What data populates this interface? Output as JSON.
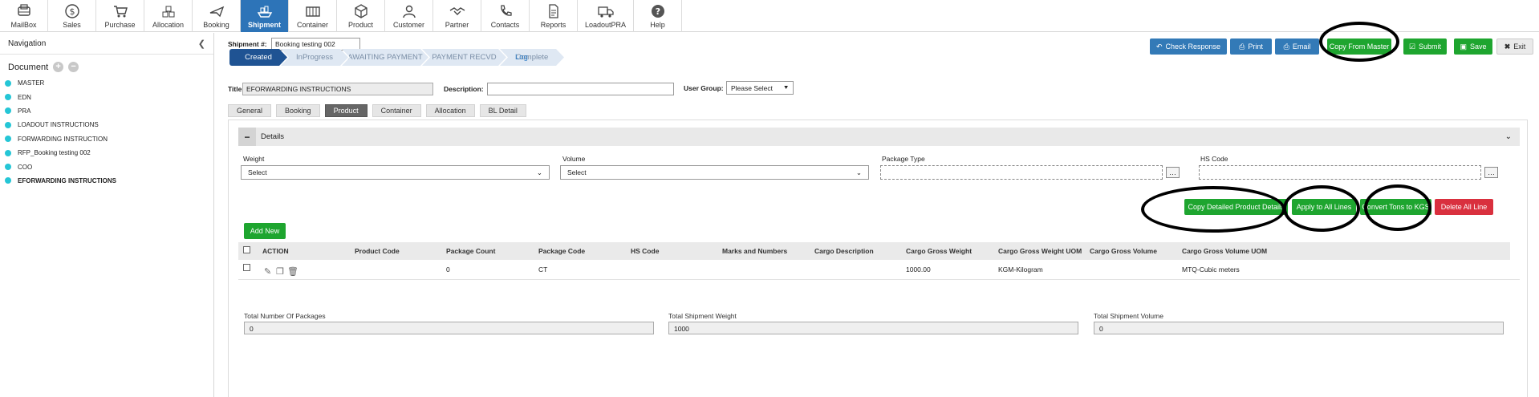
{
  "topnav": [
    {
      "label": "MailBox",
      "icon": "mailbox-icon"
    },
    {
      "label": "Sales",
      "icon": "dollar-icon"
    },
    {
      "label": "Purchase",
      "icon": "cart-icon"
    },
    {
      "label": "Allocation",
      "icon": "allocation-icon"
    },
    {
      "label": "Booking",
      "icon": "plane-icon"
    },
    {
      "label": "Shipment",
      "icon": "ship-icon",
      "active": true
    },
    {
      "label": "Container",
      "icon": "container-icon"
    },
    {
      "label": "Product",
      "icon": "box-icon"
    },
    {
      "label": "Customer",
      "icon": "customer-icon"
    },
    {
      "label": "Partner",
      "icon": "handshake-icon"
    },
    {
      "label": "Contacts",
      "icon": "phone-icon"
    },
    {
      "label": "Reports",
      "icon": "report-icon"
    },
    {
      "label": "LoadoutPRA",
      "icon": "truck-icon"
    },
    {
      "label": "Help",
      "icon": "help-icon"
    }
  ],
  "sidebar": {
    "title": "Navigation",
    "document_label": "Document",
    "items": [
      {
        "label": "MASTER"
      },
      {
        "label": "EDN"
      },
      {
        "label": "PRA"
      },
      {
        "label": "LOADOUT INSTRUCTIONS"
      },
      {
        "label": "FORWARDING INSTRUCTION"
      },
      {
        "label": "RFP_Booking testing 002"
      },
      {
        "label": "COO"
      },
      {
        "label": "EFORWARDING INSTRUCTIONS",
        "bold": true
      }
    ]
  },
  "header": {
    "shipment_label": "Shipment #:",
    "shipment_value": "Booking testing 002",
    "title_label": "Title:",
    "title_value": "EFORWARDING INSTRUCTIONS",
    "description_label": "Description:",
    "description_value": "",
    "user_group_label": "User Group:",
    "user_group_value": "Please Select"
  },
  "toolbar": {
    "check_response": "Check Response",
    "print": "Print",
    "email": "Email",
    "copy_from_master": "Copy From Master",
    "submit": "Submit",
    "save": "Save",
    "exit": "Exit"
  },
  "wizard": {
    "steps": [
      {
        "label": "Created",
        "active": true
      },
      {
        "label": "InProgress"
      },
      {
        "label": "AWAITING PAYMENT"
      },
      {
        "label": "PAYMENT RECVD"
      },
      {
        "label": "Complete"
      }
    ],
    "log": "Log"
  },
  "tabs": [
    {
      "label": "General"
    },
    {
      "label": "Booking"
    },
    {
      "label": "Product",
      "active": true
    },
    {
      "label": "Container"
    },
    {
      "label": "Allocation"
    },
    {
      "label": "BL Detail"
    }
  ],
  "details": {
    "title": "Details",
    "toggle": "−",
    "weight_label": "Weight",
    "weight_value": "Select",
    "volume_label": "Volume",
    "volume_value": "Select",
    "package_type_label": "Package Type",
    "hs_code_label": "HS Code"
  },
  "actions": {
    "copy_detailed": "Copy Detailed Product Details",
    "apply_all": "Apply to All Lines",
    "convert_tons": "Convert Tons to KGS",
    "delete_all": "Delete All Line",
    "add_new": "Add New"
  },
  "grid": {
    "columns": [
      "ACTION",
      "Product Code",
      "Package Count",
      "Package Code",
      "HS Code",
      "Marks and Numbers",
      "Cargo Description",
      "Cargo Gross Weight",
      "Cargo Gross Weight UOM",
      "Cargo Gross Volume",
      "Cargo Gross Volume UOM"
    ],
    "rows": [
      {
        "product_code": "",
        "package_count": "0",
        "package_code": "CT",
        "hs_code": "",
        "marks": "",
        "description": "",
        "gross_weight": "1000.00",
        "gross_weight_uom": "KGM-Kilogram",
        "gross_volume": "",
        "gross_volume_uom": "MTQ-Cubic meters"
      }
    ]
  },
  "totals": {
    "packages_label": "Total Number Of Packages",
    "packages_value": "0",
    "weight_label": "Total Shipment Weight",
    "weight_value": "1000",
    "volume_label": "Total Shipment Volume",
    "volume_value": "0"
  },
  "colors": {
    "primary_blue": "#337ab7",
    "active_nav": "#2d74b8",
    "green": "#1ea52f",
    "red": "#d9303e",
    "wizard_active": "#1f5393",
    "doc_dot": "#25c6d6"
  }
}
